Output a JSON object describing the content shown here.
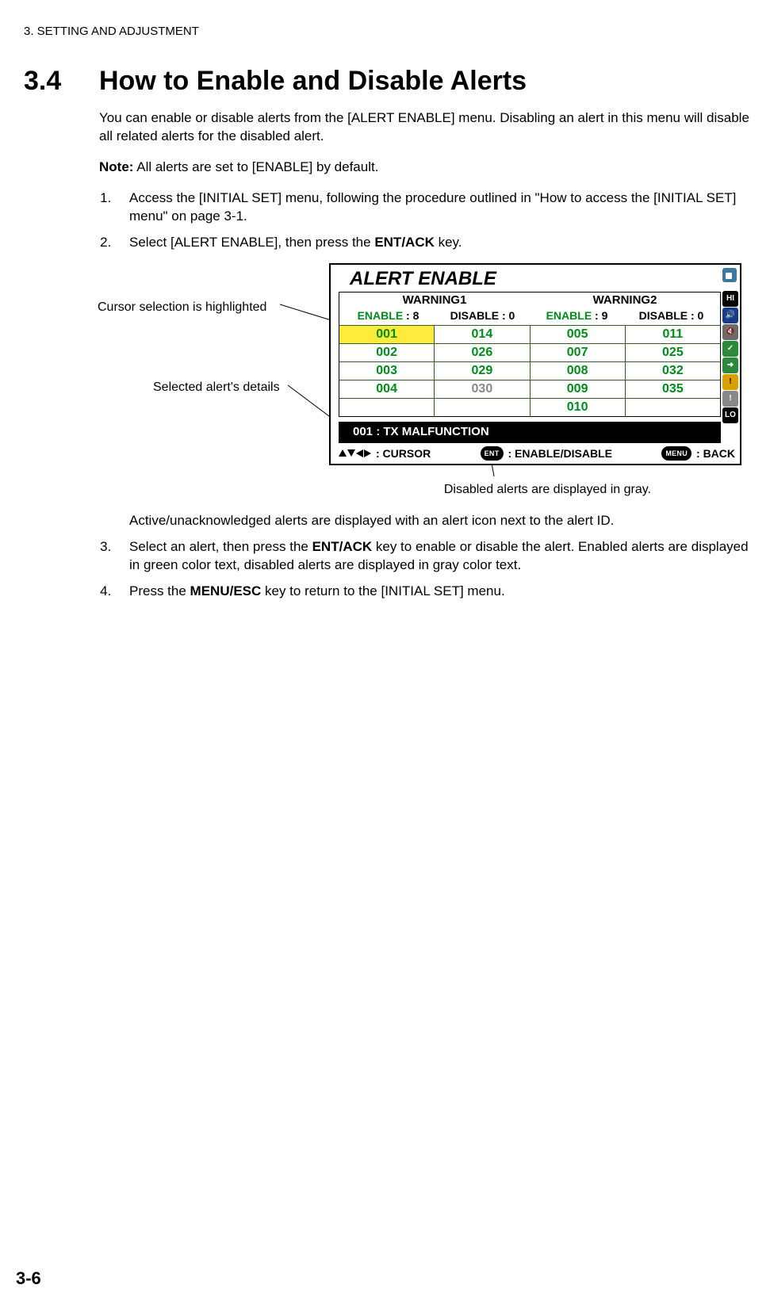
{
  "page": {
    "chapter_header": "3.  SETTING AND ADJUSTMENT",
    "section_number": "3.4",
    "section_title": "How to Enable and Disable Alerts",
    "intro": "You can enable or disable alerts from the [ALERT ENABLE] menu. Disabling an alert in this menu will disable all related alerts for the disabled alert.",
    "note_label": "Note:",
    "note_text": " All alerts are set to [ENABLE] by default.",
    "step1": "Access the [INITIAL SET] menu, following the procedure outlined in \"How to access the [INITIAL SET] menu\" on page 3-1.",
    "step2a": "Select [ALERT ENABLE], then press the ",
    "step2key": "ENT/ACK",
    "step2b": " key.",
    "after_fig": "Active/unacknowledged alerts are displayed with an alert icon next to the alert ID.",
    "step3a": "Select an alert, then press the ",
    "step3key": "ENT/ACK",
    "step3b": " key to enable or disable the alert. Enabled alerts are displayed in green color text, disabled alerts are displayed in gray color text.",
    "step4a": "Press the ",
    "step4key": "MENU/ESC",
    "step4b": " key to return to the [INITIAL SET] menu.",
    "page_number": "3-6"
  },
  "callouts": {
    "highlight": "Cursor selection is highlighted",
    "details": "Selected alert's details",
    "disabled": "Disabled alerts are displayed in gray."
  },
  "panel": {
    "title": "ALERT ENABLE",
    "w1": "WARNING1",
    "w2": "WARNING2",
    "enable_label": "ENABLE",
    "disable_label": "DISABLE",
    "w1_enable": "8",
    "w1_disable": "0",
    "w2_enable": "9",
    "w2_disable": "0",
    "cols": {
      "c1": [
        "001",
        "002",
        "003",
        "004",
        ""
      ],
      "c2": [
        "014",
        "026",
        "029",
        "030",
        ""
      ],
      "c3": [
        "005",
        "007",
        "008",
        "009",
        "010"
      ],
      "c4": [
        "011",
        "025",
        "032",
        "035",
        ""
      ]
    },
    "details_text": "001   :   TX MALFUNCTION",
    "cursor_label": ": CURSOR",
    "ent_pill": "ENT",
    "ent_label": ": ENABLE/DISABLE",
    "menu_pill": "MENU",
    "menu_label": ": BACK",
    "side": {
      "hi": "HI",
      "lo": "LO"
    }
  }
}
